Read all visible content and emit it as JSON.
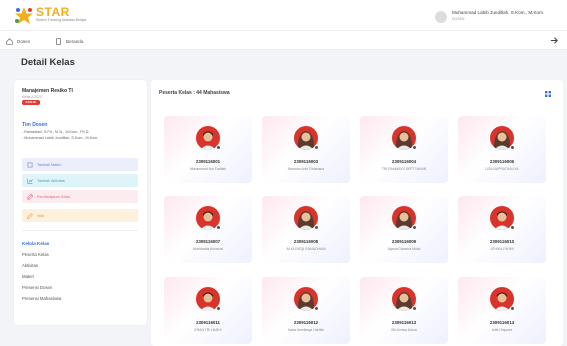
{
  "app": {
    "logo_text": "STAR",
    "logo_subtitle": "Sistem Tracking Aktivitas Belajar",
    "user_name": "Muhammad Labib Jundillah, S.Kom., M.Kom.",
    "user_role": "DOSEN"
  },
  "nav": {
    "items": [
      {
        "label": "Dosen"
      },
      {
        "label": "Beranda"
      }
    ]
  },
  "page": {
    "title": "Detail Kelas"
  },
  "course": {
    "name": "Manajemen Resiko TI",
    "subtitle": "Kelas A 2023",
    "badge": "GANJIL"
  },
  "team": {
    "title": "Tim Dosen",
    "members": [
      "- Ramadiani, S.Pd., M.Si., M.Kom., Ph.D.",
      "- Muhammad Labib Jundillah, S.Kom., M.Kom."
    ]
  },
  "actions": {
    "materi": "Tambah Materi",
    "aktivitas": "Tambah Aktivitas",
    "pengajaran": "Pembelajaran Kelas",
    "nilai": "Nilai"
  },
  "menu": {
    "title": "Kelola Kelas",
    "items": [
      "Peserta Kelas",
      "Aktivitas",
      "Materi",
      "Presensi Dosen",
      "Presensi Mahasiswa"
    ]
  },
  "main": {
    "header": "Peserta Kelas : 44 Mahasiswa"
  },
  "students": [
    {
      "nim": "2309116001",
      "name": "Muhammad Nur Fadilah",
      "gender": "m"
    },
    {
      "nim": "2309116003",
      "name": "Nauman Arini Fitriahana",
      "gender": "f"
    },
    {
      "nim": "2309116004",
      "name": "TRI RAHMAYU SEPTYAHAN",
      "gender": "f"
    },
    {
      "nim": "2309116006",
      "name": "LISA NAPRATHALIYA",
      "gender": "f"
    },
    {
      "nim": "2309116007",
      "name": "Mochtadila Akharusi",
      "gender": "m"
    },
    {
      "nim": "2309116008",
      "name": "ALYA RIZQI RAMADHANI",
      "gender": "f"
    },
    {
      "nim": "2309116009",
      "name": "Alyssa Dianeira Mutia",
      "gender": "f"
    },
    {
      "nim": "2309116010",
      "name": "ATHIKA FAHMI",
      "gender": "m"
    },
    {
      "nim": "2309116011",
      "name": "ERAN TRI HADHI",
      "gender": "m"
    },
    {
      "nim": "2309116012",
      "name": "Nada Amelissya Hardini",
      "gender": "f"
    },
    {
      "nim": "2309116013",
      "name": "Siti Annisa Adura",
      "gender": "f"
    },
    {
      "nim": "2309116014",
      "name": "Aditri Saputra",
      "gender": "m"
    }
  ],
  "colors": {
    "accent": "#3b6fd8",
    "logo": "#f2b01e",
    "badge": "#e53935"
  },
  "icons": {
    "logo": "star-logo-icon",
    "dosen": "home-icon",
    "beranda": "document-icon",
    "grid": "grid-view-icon"
  }
}
